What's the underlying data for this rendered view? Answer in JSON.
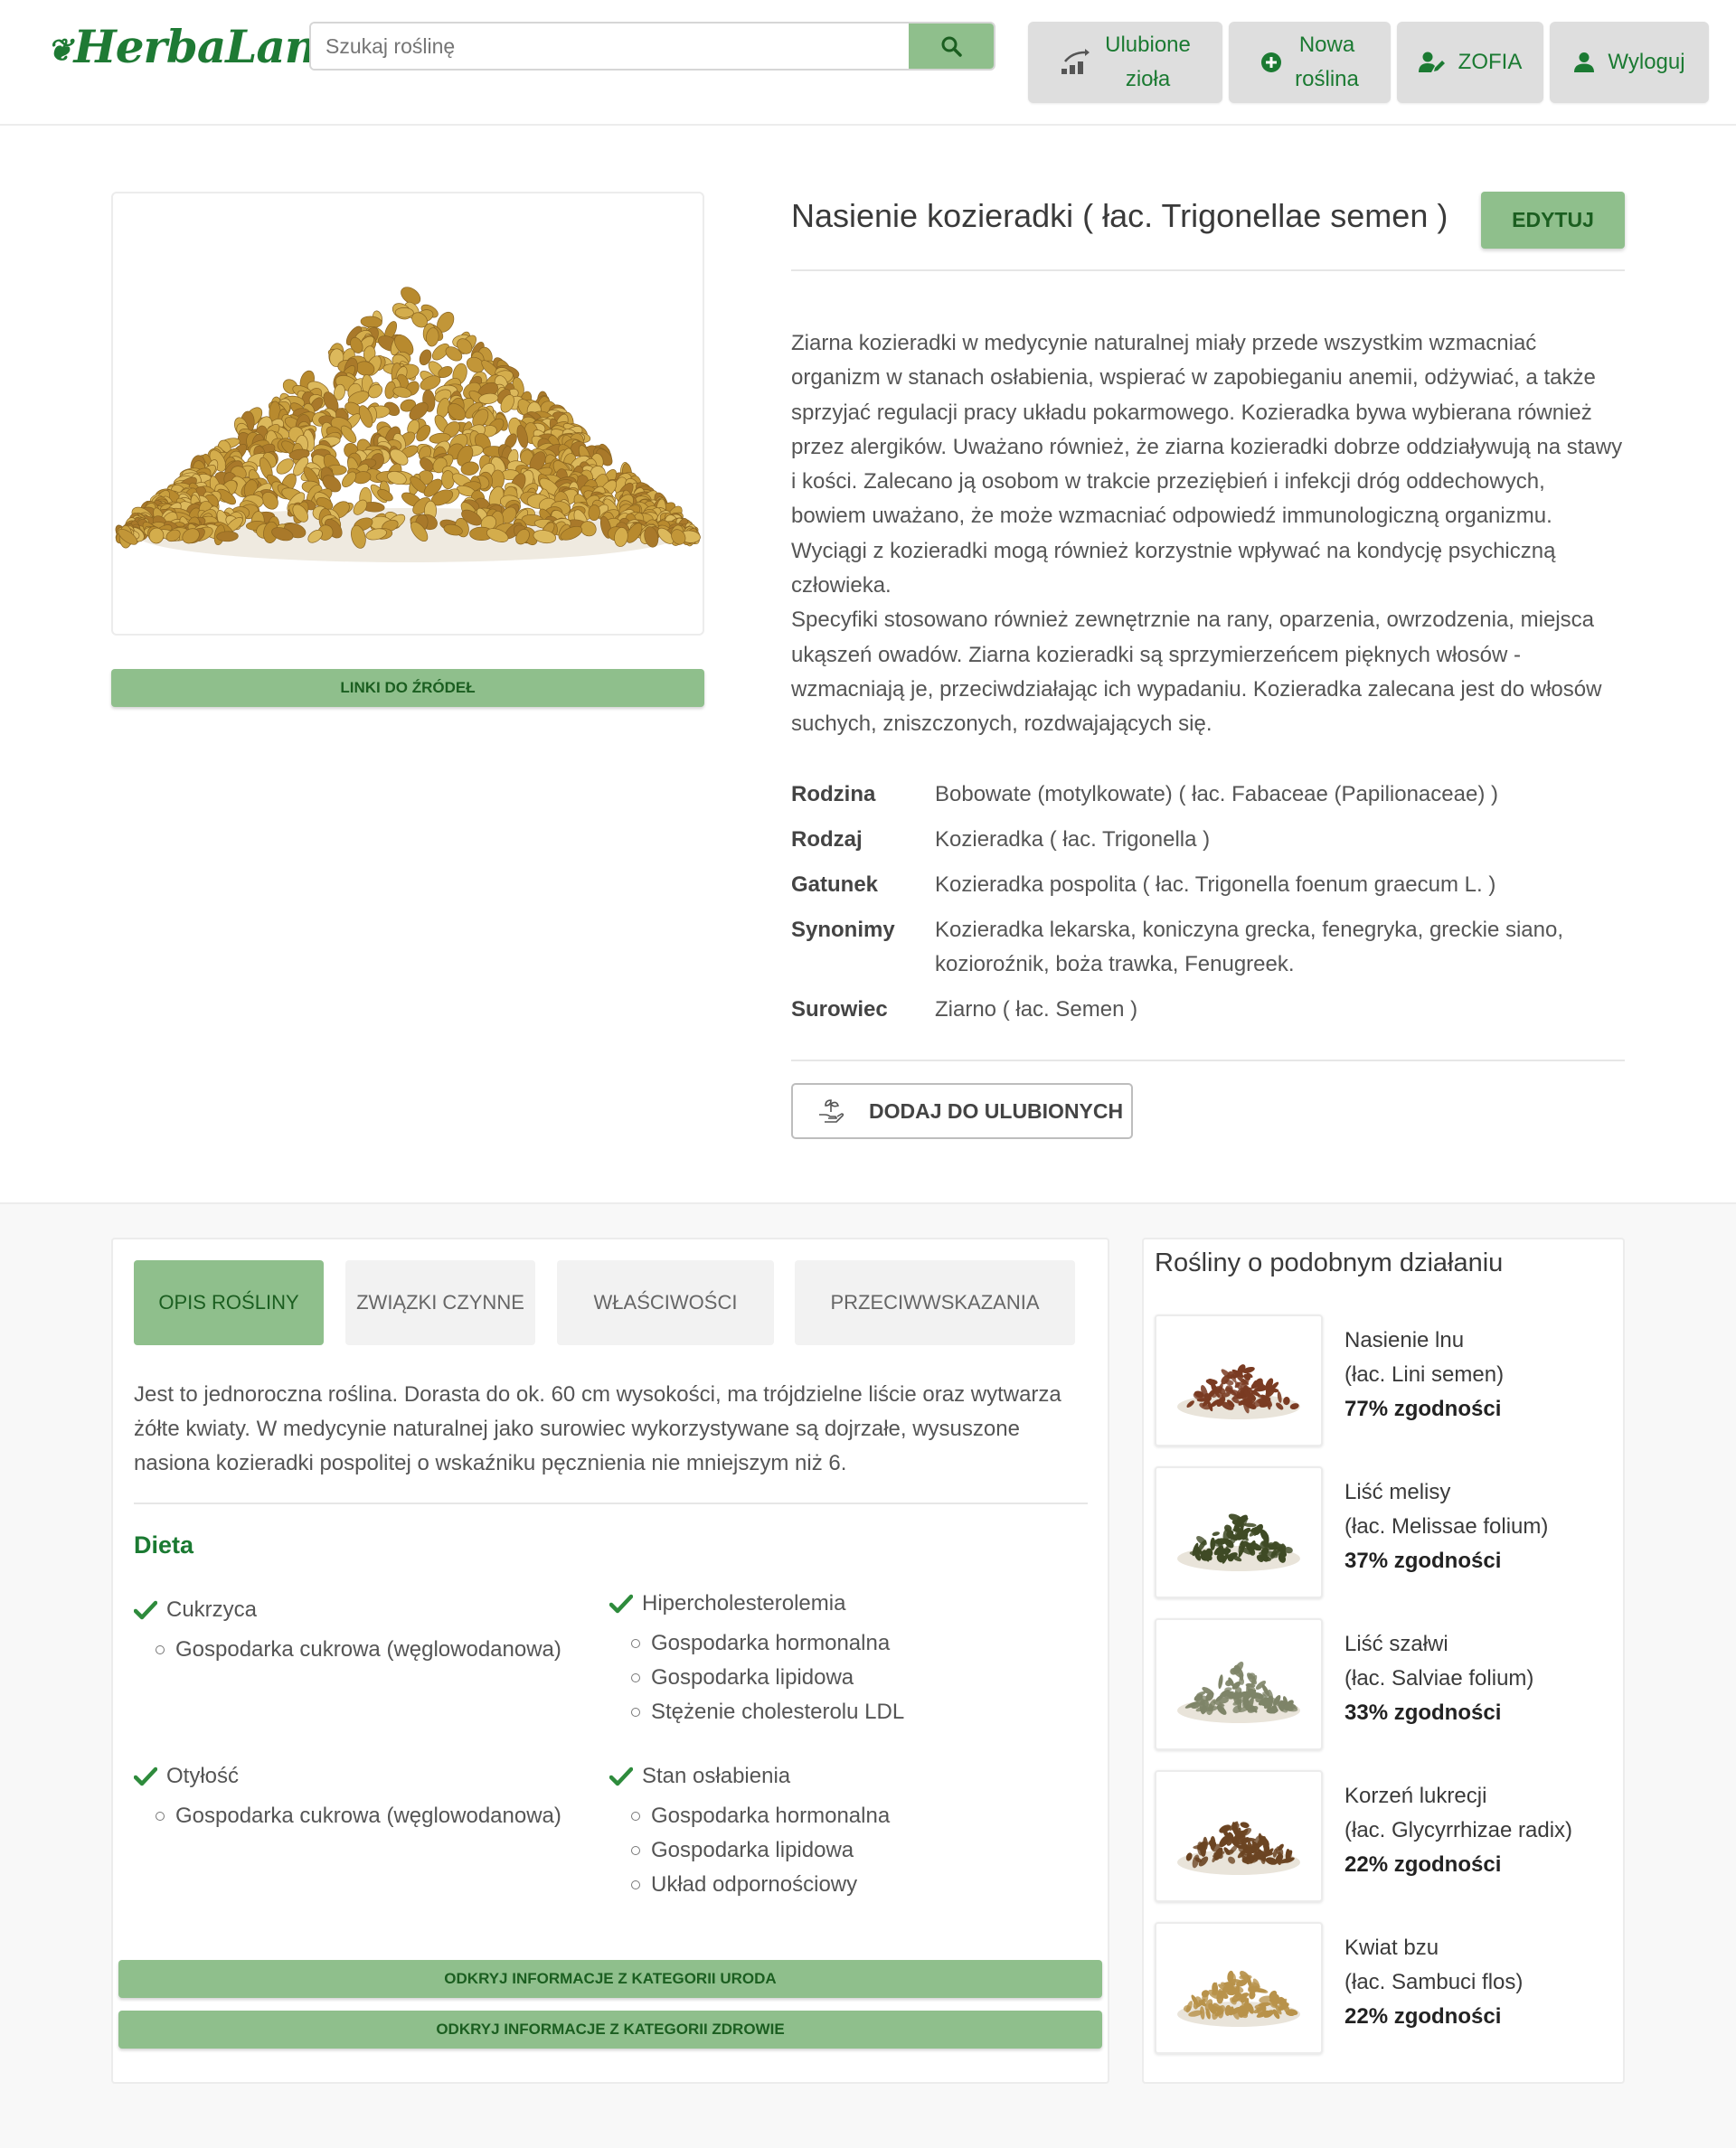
{
  "header": {
    "logo_text": "HerbaLand",
    "search_placeholder": "Szukaj roślinę",
    "nav": [
      {
        "line1": "Ulubione",
        "line2": "zioła",
        "icon": "plant-growth-icon"
      },
      {
        "line1": "Nowa",
        "line2": "roślina",
        "icon": "plus-circle-icon"
      },
      {
        "label": "ZOFIA",
        "icon": "user-edit-icon"
      },
      {
        "label": "Wyloguj",
        "icon": "user-icon"
      }
    ]
  },
  "product": {
    "title": "Nasienie kozieradki ( łac. Trigonellae semen )",
    "edit_label": "EDYTUJ",
    "sources_label": "LINKI DO ŹRÓDEŁ",
    "description": [
      "Ziarna kozieradki w medycynie naturalnej miały przede wszystkim wzmacniać",
      "organizm w stanach osłabienia, wspierać w zapobieganiu anemii, odżywiać, a także",
      "sprzyjać regulacji pracy układu pokarmowego. Kozieradka bywa wybierana również",
      "przez alergików. Uważano również, że ziarna kozieradki dobrze oddziaływują na stawy",
      "i kości. Zalecano ją osobom w trakcie przeziębień i infekcji dróg oddechowych,",
      "bowiem uważano, że może wzmacniać odpowiedź immunologiczną organizmu.",
      "Wyciągi z kozieradki mogą również korzystnie wpływać na kondycję psychiczną",
      "człowieka.",
      "Specyfiki stosowano również zewnętrznie na rany, oparzenia, owrzodzenia, miejsca",
      "ukąszeń owadów. Ziarna kozieradki są sprzymierzeńcem pięknych włosów -",
      "wzmacniają je, przeciwdziałając ich wypadaniu. Kozieradka zalecana jest do włosów",
      "suchych, zniszczonych, rozdwajających się."
    ],
    "attributes": [
      {
        "key": "Rodzina",
        "value": "Bobowate (motylkowate) ( łac. Fabaceae (Papilionaceae) )"
      },
      {
        "key": "Rodzaj",
        "value": "Kozieradka ( łac. Trigonella )"
      },
      {
        "key": "Gatunek",
        "value": "Kozieradka pospolita ( łac. Trigonella foenum graecum L. )"
      },
      {
        "key": "Synonimy",
        "value": "Kozieradka lekarska, koniczyna grecka, fenegryka, greckie siano, kozioroźnik, boża trawka, Fenugreek."
      },
      {
        "key": "Surowiec",
        "value": "Ziarno ( łac. Semen )"
      }
    ],
    "favorite_label": "DODAJ DO ULUBIONYCH"
  },
  "tabs": {
    "items": [
      "OPIS ROŚLINY",
      "ZWIĄZKI CZYNNE",
      "WŁAŚCIWOŚCI",
      "PRZECIWWSKAZANIA"
    ],
    "active_index": 0,
    "text": [
      "Jest to jednoroczna roślina. Dorasta do ok. 60 cm wysokości, ma trójdzielne liście oraz wytwarza",
      "żółte kwiaty. W medycynie naturalnej jako surowiec wykorzystywane są dojrzałe, wysuszone",
      "nasiona kozieradki pospolitej o wskaźniku pęcznienia nie mniejszym niż 6."
    ],
    "diet_title": "Dieta",
    "conditions": [
      {
        "name": "Cukrzyca",
        "items": [
          "Gospodarka cukrowa (węglowodanowa)"
        ]
      },
      {
        "name": "Hipercholesterolemia",
        "items": [
          "Gospodarka hormonalna",
          "Gospodarka lipidowa",
          "Stężenie cholesterolu LDL"
        ]
      },
      {
        "name": "Otyłość",
        "items": [
          "Gospodarka cukrowa (węglowodanowa)"
        ]
      },
      {
        "name": "Stan osłabienia",
        "items": [
          "Gospodarka hormonalna",
          "Gospodarka lipidowa",
          "Układ odpornościowy"
        ]
      }
    ],
    "category_buttons": [
      "ODKRYJ INFORMACJE Z KATEGORII URODA",
      "ODKRYJ INFORMACJE Z KATEGORII ZDROWIE"
    ]
  },
  "similar": {
    "title": "Rośliny o podobnym działaniu",
    "items": [
      {
        "name": "Nasienie lnu",
        "latin": "(łac. Lini semen)",
        "match": "77% zgodności",
        "color": "#7a3b22"
      },
      {
        "name": "Liść melisy",
        "latin": "(łac. Melissae folium)",
        "match": "37% zgodności",
        "color": "#3f4a25"
      },
      {
        "name": "Liść szałwi",
        "latin": "(łac. Salviae folium)",
        "match": "33% zgodności",
        "color": "#7e8468"
      },
      {
        "name": "Korzeń lukrecji",
        "latin": "(łac. Glycyrrhizae radix)",
        "match": "22% zgodności",
        "color": "#6b4422"
      },
      {
        "name": "Kwiat bzu",
        "latin": "(łac. Sambuci flos)",
        "match": "22% zgodności",
        "color": "#b8924a"
      }
    ]
  },
  "colors": {
    "accent": "#8fbf8c",
    "accent_text": "#1b7a32",
    "seed": "#c9a03f"
  }
}
